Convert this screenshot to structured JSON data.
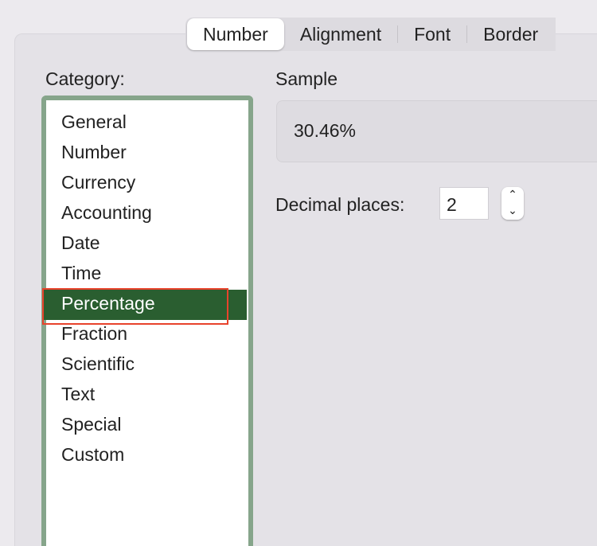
{
  "tabs": [
    "Number",
    "Alignment",
    "Font",
    "Border"
  ],
  "active_tab": "Number",
  "category": {
    "label": "Category:",
    "items": [
      "General",
      "Number",
      "Currency",
      "Accounting",
      "Date",
      "Time",
      "Percentage",
      "Fraction",
      "Scientific",
      "Text",
      "Special",
      "Custom"
    ],
    "selected": "Percentage"
  },
  "sample": {
    "label": "Sample",
    "value": "30.46%"
  },
  "decimal_places": {
    "label": "Decimal places:",
    "value": "2"
  },
  "colors": {
    "selection": "#2a5e30",
    "list_border": "#86a58b",
    "highlight": "#e8432c"
  }
}
